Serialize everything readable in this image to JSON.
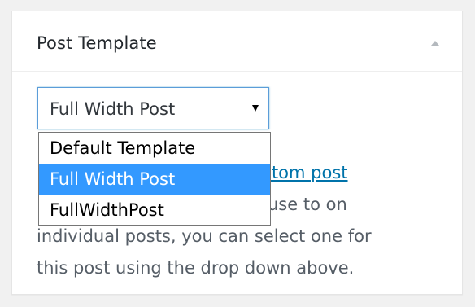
{
  "panel": {
    "title": "Post Template"
  },
  "template_select": {
    "selected": "Full Width Post",
    "options": [
      "Default Template",
      "Full Width Post",
      "FullWidthPost"
    ]
  },
  "help": {
    "link_text": "stom post",
    "line2": "use to on",
    "line3": "individual posts, you can select one for",
    "line4": "this post using the drop down above."
  },
  "colors": {
    "highlight": "#3399ff",
    "link": "#0073aa"
  }
}
